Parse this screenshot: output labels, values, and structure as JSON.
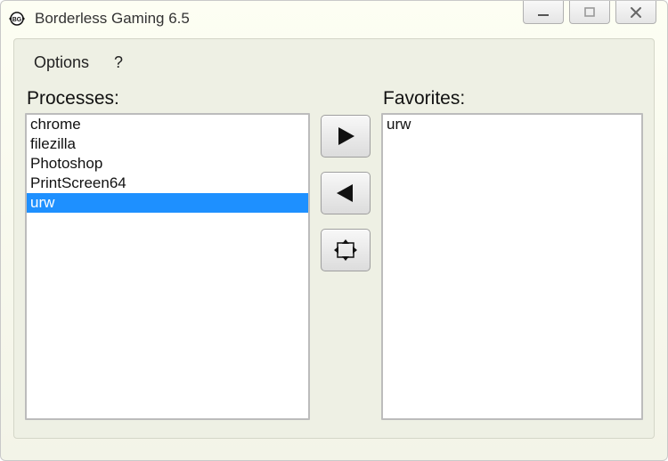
{
  "window": {
    "title": "Borderless Gaming 6.5"
  },
  "menu": {
    "options": "Options",
    "help": "?"
  },
  "labels": {
    "processes": "Processes:",
    "favorites": "Favorites:"
  },
  "processes": {
    "items": [
      "chrome",
      "filezilla",
      "Photoshop",
      "PrintScreen64",
      "urw"
    ],
    "selected_index": 4
  },
  "favorites": {
    "items": [
      "urw"
    ],
    "selected_index": -1
  }
}
